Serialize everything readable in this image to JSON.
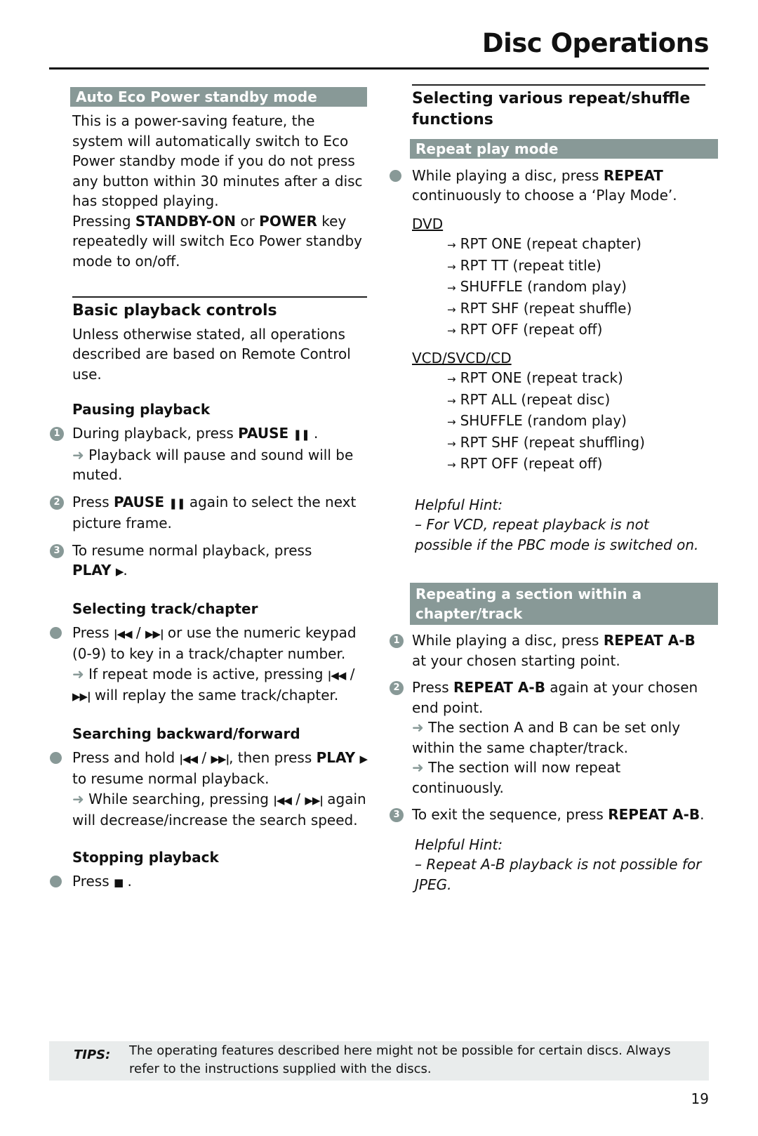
{
  "header": {
    "title": "Disc Operations"
  },
  "left": {
    "eco": {
      "bar_title": "Auto Eco Power standby mode",
      "para1": "This is a power-saving feature, the system will automatically switch to Eco Power standby mode if you do not press any button within 30 minutes after a disc has stopped playing.",
      "para2_pre": "Pressing ",
      "para2_b1": "STANDBY-ON",
      "para2_mid": " or ",
      "para2_b2": "POWER",
      "para2_post": " key repeatedly will switch Eco Power standby mode to on/off."
    },
    "basic": {
      "heading": "Basic playback controls",
      "intro": "Unless otherwise stated, all operations described are based on Remote Control use."
    },
    "pausing": {
      "heading": "Pausing playback",
      "step1_num": "1",
      "step1_pre": "During playback, press ",
      "step1_b": "PAUSE",
      "step1_sym": "❚❚",
      "step1_post": " .",
      "step1_arrow": "➜",
      "step1_result": " Playback will pause and sound will be muted.",
      "step2_num": "2",
      "step2_pre": "Press ",
      "step2_b": "PAUSE",
      "step2_sym": "❚❚",
      "step2_post": "  again to select the next picture frame.",
      "step3_num": "3",
      "step3_pre": "To resume normal playback, press ",
      "step3_b": "PLAY",
      "step3_sym": "▶",
      "step3_post": "."
    },
    "selecting": {
      "heading": "Selecting track/chapter",
      "pre": "Press ",
      "prev": "|◀◀",
      "sep": " / ",
      "next": "▶▶|",
      "post": " or use the numeric keypad (0-9) to key in a track/chapter number.",
      "arrow": "➜",
      "result_pre": " If repeat mode is active, pressing ",
      "result_post": "  will replay the same track/chapter."
    },
    "searching": {
      "heading": "Searching backward/forward",
      "pre": "Press and hold ",
      "mid": ", then press ",
      "play_b": "PLAY",
      "play_sym": "▶",
      "post": " to resume normal playback.",
      "arrow": "➜",
      "result_pre": " While searching, pressing ",
      "result_post": " again will decrease/increase the search speed."
    },
    "stopping": {
      "heading": "Stopping playback",
      "pre": "Press ",
      "sym": "■",
      "post": " ."
    }
  },
  "right": {
    "heading": "Selecting various repeat/shuffle functions",
    "repeat_bar": "Repeat play mode",
    "repeat_pre": "While playing a disc, press ",
    "repeat_b": "REPEAT",
    "repeat_post": " continuously to choose a ‘Play Mode’.",
    "dvd_label": "DVD",
    "dvd_items": [
      "RPT ONE (repeat chapter)",
      "RPT TT (repeat title)",
      "SHUFFLE (random play)",
      "RPT SHF (repeat shuffle)",
      "RPT OFF (repeat off)"
    ],
    "vcd_label": "VCD/SVCD/CD",
    "vcd_items": [
      "RPT ONE (repeat track)",
      "RPT ALL (repeat disc)",
      "SHUFFLE (random play)",
      "RPT SHF (repeat shuffling)",
      "RPT OFF (repeat off)"
    ],
    "list_arrow": "→",
    "hint1_title": "Helpful Hint:",
    "hint1_text": "–     For VCD, repeat playback is not possible if the PBC mode is switched on.",
    "ab_bar": "Repeating a section within a chapter/track",
    "ab1_num": "1",
    "ab1_pre": "While playing a disc, press ",
    "ab1_b": "REPEAT A-B",
    "ab1_post": " at your chosen starting point.",
    "ab2_num": "2",
    "ab2_pre": "Press ",
    "ab2_b": "REPEAT A-B",
    "ab2_post": " again at your chosen end point.",
    "ab2_arrow": "➜",
    "ab2_r1": " The section A and B can be set only within the same chapter/track.",
    "ab2_r2": " The section will now repeat continuously.",
    "ab3_num": "3",
    "ab3_pre": "To exit the sequence, press ",
    "ab3_b": "REPEAT A-B",
    "ab3_post": ".",
    "hint2_title": "Helpful Hint:",
    "hint2_text": "–     Repeat A-B playback is not possible for JPEG."
  },
  "tips": {
    "label": "TIPS:",
    "text": "The operating features described here might not be possible for certain discs.  Always refer to the instructions supplied with the discs."
  },
  "page_number": "19"
}
